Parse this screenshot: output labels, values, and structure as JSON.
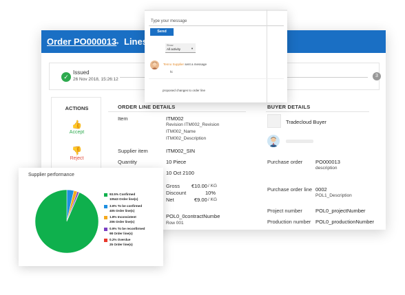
{
  "header": {
    "order_link": "Order PO000013",
    "arrow": "→",
    "section": "Lines"
  },
  "timeline": {
    "step1_status": "Issued",
    "step1_date": "26 Nov 2018, 15:26:12",
    "step1_icon": "check-icon",
    "step3_number": "3"
  },
  "actions": {
    "title": "ACTIONS",
    "accept_label": "Accept",
    "accept_icon": "thumbs-up-icon",
    "reject_label": "Reject",
    "reject_icon": "thumbs-down-icon"
  },
  "order_line": {
    "heading": "ORDER LINE DETAILS",
    "item_label": "Item",
    "item_code": "ITM002",
    "item_revision": "Revision ITM002_Revision",
    "item_name": "ITM002_Name",
    "item_description": "ITM002_Description",
    "supplier_item_label": "Supplier item",
    "supplier_item_value": "ITM002_SIN",
    "quantity_label": "Quantity",
    "quantity_value": "10 Piece",
    "date_value": "10 Oct 2100",
    "gross_label": "Gross",
    "gross_value": "€10.00",
    "gross_unit": "/ KG",
    "discount_label": "Discount",
    "discount_value": "10%",
    "net_label": "Net",
    "net_value": "€9.00",
    "net_unit": "/ KG",
    "contract_number": "POL0_0contractNumbe",
    "contract_row": "Row 001"
  },
  "buyer": {
    "heading": "BUYER DETAILS",
    "company_name": "Tradecloud Buyer",
    "purchase_order_label": "Purchase order",
    "purchase_order_value": "PO000013",
    "purchase_order_desc": "description",
    "order_line_label": "Purchase order line",
    "order_line_value": "0002",
    "order_line_desc": "POL1_Description",
    "project_label": "Project number",
    "project_value": "POL0_projectNumber",
    "production_label": "Production number",
    "production_value": "POL0_productionNumber"
  },
  "message": {
    "placeholder": "Type your message",
    "send_label": "Send",
    "filter_label": "Show",
    "filter_value": "All activity",
    "sender_name": "Tenno Supplier",
    "sender_action": "sent a message",
    "to_text": "hi",
    "proposed_text": "proposed changes to order line"
  },
  "performance": {
    "title": "Supplier performance",
    "colors": {
      "confirmed": "#0fb04d",
      "to_be_confirmed": "#1e8fe0",
      "inconsistent": "#f4a91e",
      "to_be_reconfirmed": "#7a3fc2",
      "overdue": "#e8392c"
    },
    "legend": [
      {
        "line1": "93.5% Confirmed",
        "line2": "10543 Order line(s)"
      },
      {
        "line1": "3.6% To be confirmed",
        "line2": "405 Order line(s)"
      },
      {
        "line1": "1.8% Inconsistent",
        "line2": "206 Order line(s)"
      },
      {
        "line1": "0.9% To be reconfirmed",
        "line2": "98 Order line(s)"
      },
      {
        "line1": "0.2% Overdue",
        "line2": "25 Order line(s)"
      }
    ]
  },
  "chart_data": {
    "type": "pie",
    "categories": [
      "Confirmed",
      "To be confirmed",
      "Inconsistent",
      "To be reconfirmed",
      "Overdue"
    ],
    "values": [
      93.5,
      3.6,
      1.8,
      0.9,
      0.2
    ],
    "counts": [
      10543,
      405,
      206,
      98,
      25
    ],
    "colors": [
      "#0fb04d",
      "#1e8fe0",
      "#f4a91e",
      "#7a3fc2",
      "#e8392c"
    ],
    "title": "Supplier performance"
  }
}
